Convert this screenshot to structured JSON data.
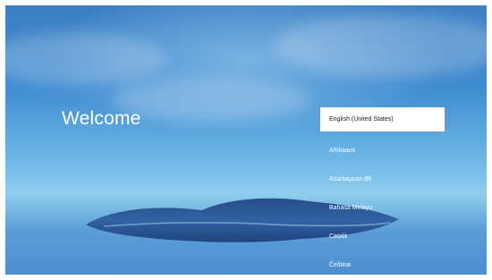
{
  "welcome": {
    "title": "Welcome"
  },
  "languages": [
    {
      "label": "English (United States)",
      "selected": true
    },
    {
      "label": "Afrikaans",
      "selected": false
    },
    {
      "label": "Azərbaycan dili",
      "selected": false
    },
    {
      "label": "Bahasa Melayu",
      "selected": false
    },
    {
      "label": "Català",
      "selected": false
    },
    {
      "label": "Čeština",
      "selected": false
    }
  ],
  "colors": {
    "sky_top": "#3c7fc4",
    "horizon": "#8fcdee",
    "selection_bg": "#ffffff",
    "text_light": "#ffffff",
    "text_dark": "#222222"
  }
}
